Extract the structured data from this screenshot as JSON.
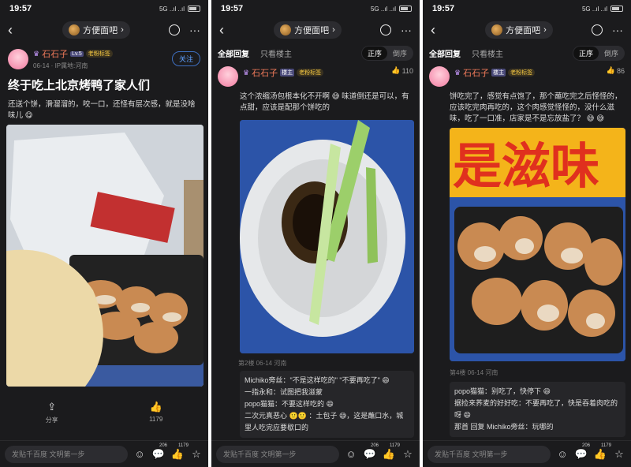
{
  "status": {
    "time": "19:57",
    "signal": "5G ..ıl ..ıl"
  },
  "nav": {
    "forum_name": "方便面吧",
    "back_icon": "chevron-left-icon",
    "share_icon": "share-icon",
    "more_icon": "more-icon"
  },
  "panel1": {
    "author": "石石子",
    "level": "Lv.5",
    "medal": "老粉标签",
    "meta": "06-14 · IP属地:河南",
    "follow": "关注",
    "title": "终于吃上北京烤鸭了家人们",
    "body": "还送个饼，滑溜溜的，咬一口，还怪有层次感，就是没啥味儿 😋",
    "actions": [
      {
        "icon": "share-icon",
        "label": "分享"
      },
      {
        "icon": "thumb-up-icon",
        "label": "1179"
      }
    ]
  },
  "panel2": {
    "tabs": [
      "全部回复",
      "只看楼主"
    ],
    "sort": [
      "正序",
      "倒序"
    ],
    "author": "石石子",
    "level": "楼主",
    "medal": "老粉标签",
    "likes": "110",
    "body": "这个浓缩汤包根本化不开啊 😅 味道倒还是可以，有点甜，应该是配那个饼吃的",
    "floor": "第2楼 06-14 河南",
    "subreplies": [
      "Michiko旁丝：\"不是这样吃的\" \"不要再吃了\" 😄",
      "一指永和：试图把我滋蒙",
      "popo猫猫：不要这样吃的 😄",
      "二次元真恶心 🙂🙂 ：土包子 😅，这是蘸口水，城里人吃完应要歇口的"
    ]
  },
  "panel3": {
    "tabs": [
      "全部回复",
      "只看楼主"
    ],
    "sort": [
      "正序",
      "倒序"
    ],
    "author": "石石子",
    "level": "楼主",
    "medal": "老粉标签",
    "likes": "86",
    "body": "饼吃完了，感觉有点饱了，那个蘸吃完之后怪怪的，应该吃完肉再吃的，这个肉感觉怪怪的，没什么滋味，吃了一口准，店家是不是忘放盐了？ 😅 😅",
    "banner_text": "是滋味",
    "floor": "第4楼 06-14 河南",
    "subreplies": [
      "popo猫猫：别吃了，快停下 😄",
      "据捡来荞麦的好好吃：不要再吃了，快是吞着肉吃的呀 😄",
      "那首 回复 Michiko旁丝：玩哪的"
    ]
  },
  "bottom": {
    "placeholder": "发贴千百度 文明第一步",
    "emoji_icon": "emoji-icon",
    "comment_count": "206",
    "like_count": "1179",
    "star_icon": "star-icon"
  },
  "colors": {
    "bg": "#1b1b1d",
    "accent_name": "#f07a5a",
    "follow_blue": "#5ea0ff"
  }
}
